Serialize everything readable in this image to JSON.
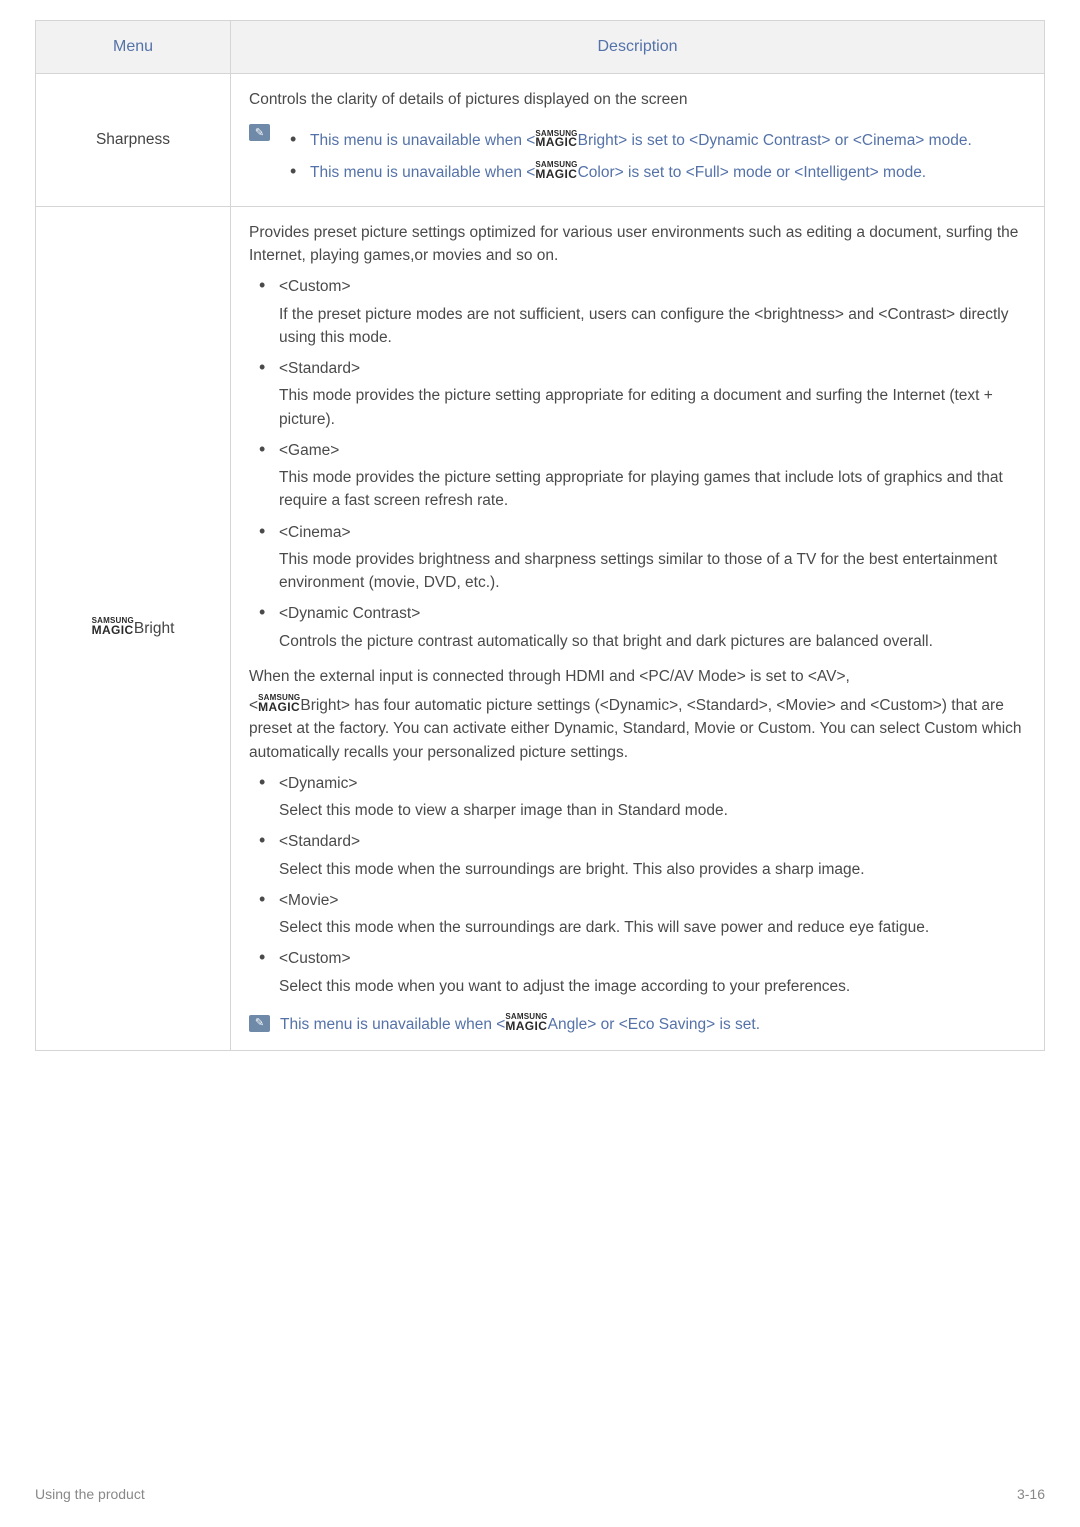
{
  "headers": {
    "menu": "Menu",
    "description": "Description"
  },
  "rows": {
    "sharpness": {
      "label": "Sharpness",
      "intro": "Controls the clarity of details of pictures displayed on the screen",
      "note1_pre": "This menu is unavailable when <",
      "note1_mid": "Bright> is set to <Dynamic Contrast> or <Cinema> mode.",
      "note2_pre": "This menu is unavailable when <",
      "note2_mid": "Color> is set to <Full> mode or <Intelligent> mode."
    },
    "magicBright": {
      "label_suffix": "Bright",
      "intro": "Provides preset picture settings optimized for various user environments such as editing a document, surfing the Internet, playing games,or movies and so on.",
      "items1": [
        {
          "head": "<Custom>",
          "body": "If the preset picture modes are not sufficient, users can configure the <brightness> and <Contrast> directly using this mode."
        },
        {
          "head": "<Standard>",
          "body": " This mode provides the picture setting appropriate for editing a document and surfing the Internet (text + picture)."
        },
        {
          "head": "<Game>",
          "body": "This mode provides the picture setting appropriate for playing games that include lots of graphics and that require a fast screen refresh rate."
        },
        {
          "head": "<Cinema>",
          "body": "This mode provides brightness and sharpness settings similar to those of a TV for the best entertainment environment (movie, DVD, etc.)."
        },
        {
          "head": "<Dynamic Contrast>",
          "body": "Controls the picture contrast automatically so that bright and dark pictures are balanced overall."
        }
      ],
      "mid1": "When the external input is connected through HDMI and <PC/AV Mode> is set to <AV>,",
      "mid2_pre": "<",
      "mid2_post": "Bright> has four automatic picture settings (<Dynamic>, <Standard>, <Movie> and <Custom>) that are preset at the factory. You can activate either Dynamic, Standard, Movie or Custom. You can select Custom which automatically recalls your personalized picture settings.",
      "items2": [
        {
          "head": "<Dynamic>",
          "body": "Select this mode to view a sharper image than in Standard mode."
        },
        {
          "head": "<Standard>",
          "body": "Select this mode when the surroundings are bright. This also provides a sharp image."
        },
        {
          "head": "<Movie>",
          "body": "Select this mode when the surroundings are dark. This will save power and reduce eye fatigue."
        },
        {
          "head": "<Custom>",
          "body": "Select this mode when you want to adjust the image according to your preferences."
        }
      ],
      "note_pre": "This menu is unavailable when <",
      "note_post": "Angle> or <Eco Saving> is set."
    }
  },
  "brand": {
    "top": "SAMSUNG",
    "bot": "MAGIC"
  },
  "footer": {
    "left": "Using the product",
    "right": "3-16"
  }
}
